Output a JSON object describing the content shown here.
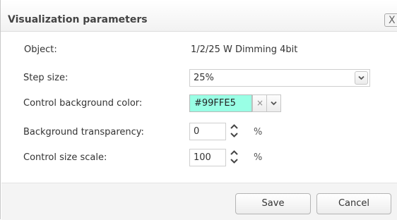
{
  "dialog": {
    "title": "Visualization parameters",
    "close_symbol": "X"
  },
  "fields": {
    "object": {
      "label": "Object:",
      "value": "1/2/25 W Dimming 4bit"
    },
    "step_size": {
      "label": "Step size:",
      "value": "25%"
    },
    "bg_color": {
      "label": "Control background color:",
      "value": "#99FFE5",
      "swatch_color": "#99FFE5",
      "clear_symbol": "×"
    },
    "bg_transparency": {
      "label": "Background transparency:",
      "value": "0",
      "unit": "%"
    },
    "size_scale": {
      "label": "Control size scale:",
      "value": "100",
      "unit": "%"
    }
  },
  "buttons": {
    "save": "Save",
    "cancel": "Cancel"
  },
  "icons": {
    "dropdown": "chevron-down-icon",
    "spinner": "spinner-arrows-icon",
    "clear": "clear-x-icon",
    "close": "close-icon"
  }
}
